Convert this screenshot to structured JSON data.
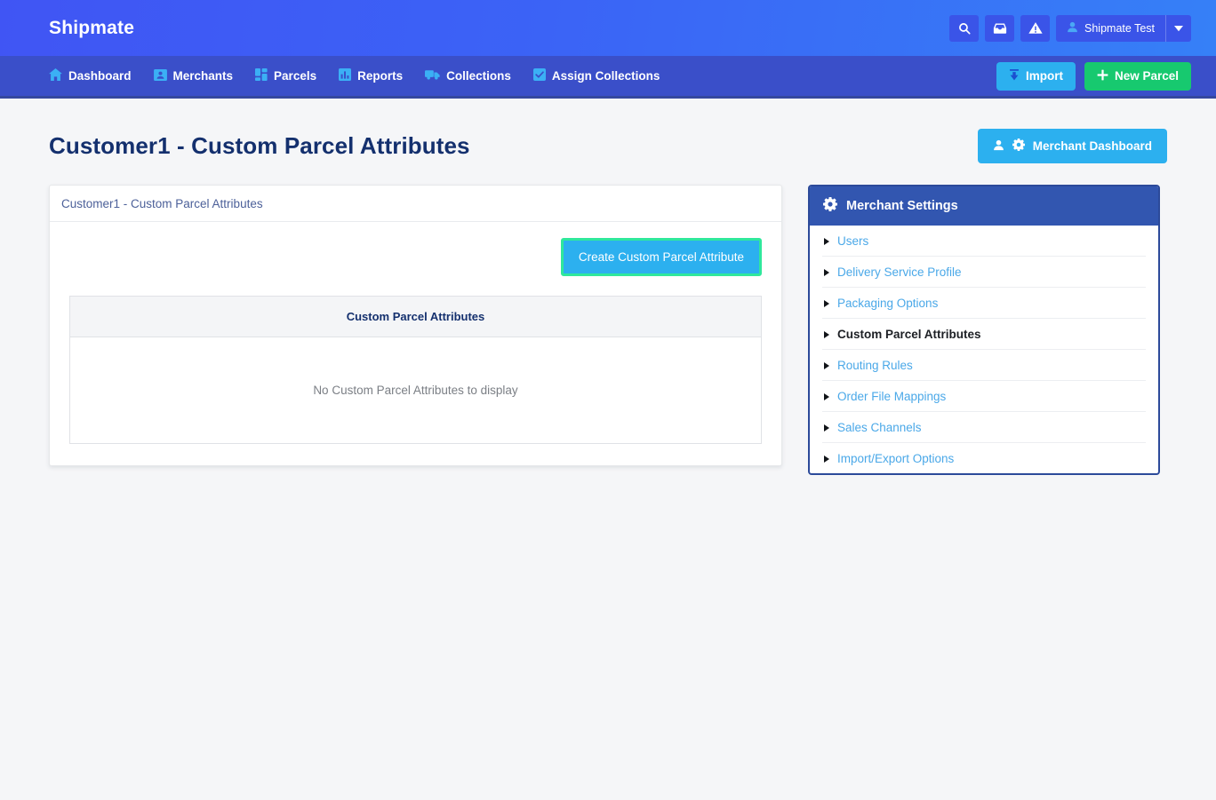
{
  "header": {
    "brand": "Shipmate",
    "icons": [
      {
        "name": "search-icon",
        "label": "Search"
      },
      {
        "name": "inbox-icon",
        "label": "Inbox"
      },
      {
        "name": "alert-triangle-icon",
        "label": "Alerts"
      }
    ],
    "user": {
      "name": "Shipmate Test",
      "avatar_icon": "user-icon",
      "caret_icon": "chevron-down-icon"
    }
  },
  "nav": {
    "items": [
      {
        "label": "Dashboard",
        "icon": "home-icon"
      },
      {
        "label": "Merchants",
        "icon": "id-card-icon"
      },
      {
        "label": "Parcels",
        "icon": "grid-squares-icon"
      },
      {
        "label": "Reports",
        "icon": "bar-chart-icon"
      },
      {
        "label": "Collections",
        "icon": "truck-icon"
      },
      {
        "label": "Assign Collections",
        "icon": "check-square-icon"
      }
    ],
    "import_label": "Import",
    "import_icon": "upload-icon",
    "new_parcel_label": "New Parcel",
    "new_parcel_icon": "plus-icon"
  },
  "page": {
    "title": "Customer1 - Custom Parcel Attributes",
    "merchant_dashboard_label": "Merchant Dashboard",
    "merchant_dashboard_icons": [
      "user-icon",
      "gear-icon"
    ]
  },
  "card": {
    "title": "Customer1 - Custom Parcel Attributes",
    "create_button_label": "Create Custom Parcel Attribute",
    "table": {
      "columns": [
        "Custom Parcel Attributes"
      ],
      "rows": [],
      "empty_message": "No Custom Parcel Attributes to display"
    }
  },
  "sidebar": {
    "title": "Merchant Settings",
    "title_icon": "gear-icon",
    "items": [
      {
        "label": "Users",
        "active": false
      },
      {
        "label": "Delivery Service Profile",
        "active": false
      },
      {
        "label": "Packaging Options",
        "active": false
      },
      {
        "label": "Custom Parcel Attributes",
        "active": true
      },
      {
        "label": "Routing Rules",
        "active": false
      },
      {
        "label": "Order File Mappings",
        "active": false
      },
      {
        "label": "Sales Channels",
        "active": false
      },
      {
        "label": "Import/Export Options",
        "active": false
      }
    ]
  },
  "colors": {
    "brand_blue": "#3b62f6",
    "nav_blue": "#3a4fc9",
    "accent_light_blue": "#2cb0ef",
    "success_green": "#17c96f",
    "focus_ring_green": "#2fe89c",
    "panel_blue": "#3256b0",
    "title_navy": "#14306e"
  }
}
